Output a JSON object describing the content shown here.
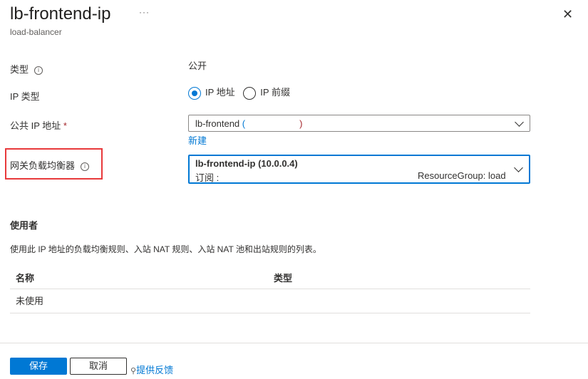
{
  "header": {
    "title": "lb-frontend-ip",
    "more": "···",
    "subtitle": "load-balancer",
    "close": "✕"
  },
  "form": {
    "type": {
      "label": "类型",
      "value": "公开"
    },
    "ip_type": {
      "label": "IP 类型",
      "options": [
        "IP 地址",
        "IP 前缀"
      ],
      "selected": "IP 地址"
    },
    "public_ip": {
      "label": "公共 IP 地址",
      "required": "*",
      "value_name": "lb-frontend",
      "value_open": "(",
      "value_close": ")",
      "create_new": "新建"
    },
    "gateway_lb": {
      "label": "网关负载均衡器",
      "value": "lb-frontend-ip (10.0.0.4)",
      "subscription_label": "订阅 :",
      "resource_group": "ResourceGroup: load"
    }
  },
  "usage": {
    "title": "使用者",
    "description": "使用此 IP 地址的负载均衡规则、入站 NAT 规则、入站 NAT 池和出站规则的列表。",
    "columns": [
      "名称",
      "类型"
    ],
    "rows": [
      [
        "未使用",
        ""
      ]
    ]
  },
  "footer": {
    "save": "保存",
    "cancel": "取消",
    "feedback": "提供反馈"
  },
  "colors": {
    "accent": "#0078d4",
    "highlight": "#e8393b",
    "required": "#a4262c"
  }
}
